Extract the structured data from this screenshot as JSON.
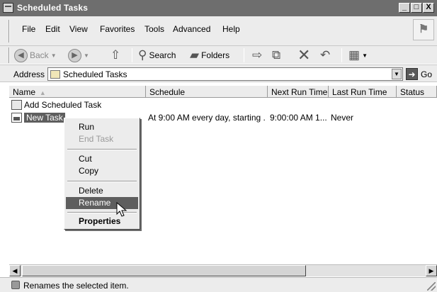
{
  "window": {
    "title": "Scheduled Tasks",
    "controls": {
      "minimize": "_",
      "maximize": "□",
      "close": "X"
    }
  },
  "menubar": {
    "items": [
      "File",
      "Edit",
      "View",
      "Favorites",
      "Tools",
      "Advanced",
      "Help"
    ]
  },
  "toolbar": {
    "back_label": "Back",
    "search_label": "Search",
    "folders_label": "Folders"
  },
  "address": {
    "label": "Address",
    "value": "Scheduled Tasks",
    "go_label": "Go"
  },
  "list": {
    "columns": [
      "Name",
      "Schedule",
      "Next Run Time",
      "Last Run Time",
      "Status"
    ],
    "rows": [
      {
        "name": "Add Scheduled Task",
        "schedule": "",
        "next_run": "",
        "last_run": "",
        "status": ""
      },
      {
        "name": "New Task",
        "schedule": "At 9:00 AM every day, starting ...",
        "next_run": "9:00:00 AM  1...",
        "last_run": "Never",
        "status": ""
      }
    ]
  },
  "context_menu": {
    "items": [
      "Run",
      "End Task",
      "Cut",
      "Copy",
      "Delete",
      "Rename",
      "Properties"
    ]
  },
  "statusbar": {
    "text": "Renames the selected item."
  },
  "icons": {
    "app": "scheduled-tasks-icon",
    "back": "back-arrow-icon",
    "forward": "forward-arrow-icon",
    "up": "up-folder-icon",
    "search": "search-icon",
    "folders": "folders-icon",
    "move": "move-to-icon",
    "copy": "copy-to-icon",
    "delete": "delete-icon",
    "undo": "undo-icon",
    "views": "views-icon",
    "cursor": "mouse-pointer-icon"
  }
}
